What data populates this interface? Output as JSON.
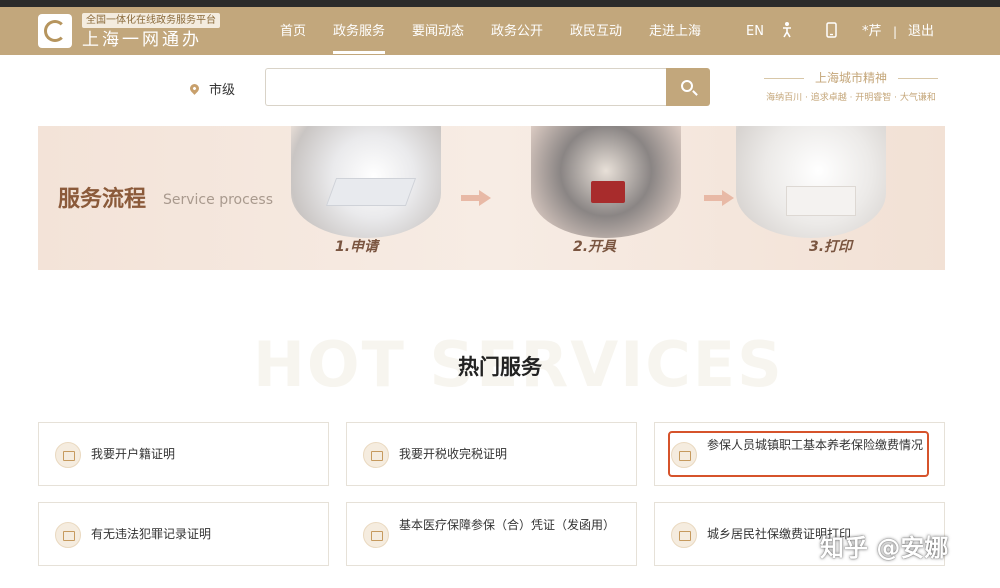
{
  "header": {
    "logo_tag": "全国一体化在线政务服务平台",
    "logo_name": "上海一网通办",
    "nav": [
      "首页",
      "政务服务",
      "要闻动态",
      "政务公开",
      "政民互动",
      "走进上海"
    ],
    "active_nav": "政务服务",
    "lang": "EN",
    "user": "*芹",
    "sep": "|",
    "logout": "退出"
  },
  "search": {
    "location": "市级",
    "placeholder": "",
    "spirit_title": "上海城市精神",
    "spirit_sub": "海纳百川 · 追求卓越 · 开明睿智 · 大气谦和"
  },
  "process": {
    "title": "服务流程",
    "subtitle": "Service process",
    "steps": [
      "1.申请",
      "2.开具",
      "3.打印"
    ]
  },
  "hot": {
    "bg_text": "HOT SERVICES",
    "title": "热门服务",
    "cards": [
      "我要开户籍证明",
      "我要开税收完税证明",
      "参保人员城镇职工基本养老保险缴费情况",
      "有无违法犯罪记录证明",
      "基本医疗保障参保（合）凭证（发函用）",
      "城乡居民社保缴费证明打印"
    ],
    "highlighted_card": 2
  },
  "watermark": "知乎 @安娜",
  "colors": {
    "brand": "#c2a77c",
    "highlight_border": "#d6532b",
    "process_bg": "#f3e3d8"
  }
}
